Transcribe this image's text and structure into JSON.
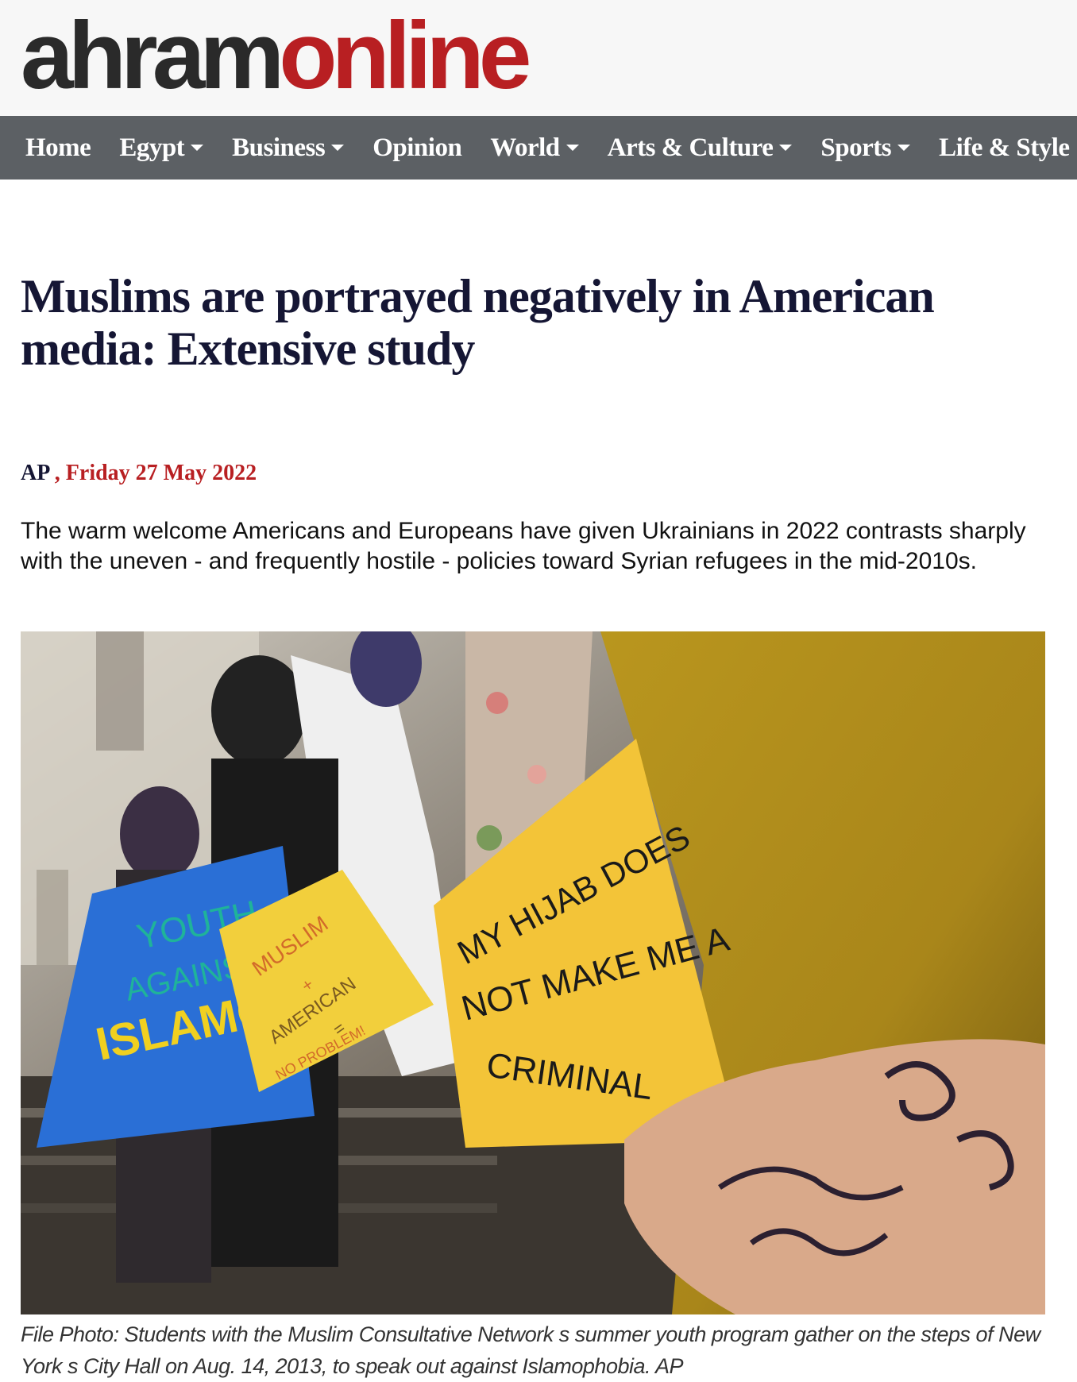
{
  "site": {
    "logo_part1": "ahram",
    "logo_part2": "online",
    "colors": {
      "brand_dark": "#2a2a2a",
      "brand_red": "#b81f22",
      "nav_bg": "#5c6064",
      "headline": "#151634"
    }
  },
  "nav": {
    "items": [
      {
        "label": "Home",
        "dropdown": false
      },
      {
        "label": "Egypt",
        "dropdown": true
      },
      {
        "label": "Business",
        "dropdown": true
      },
      {
        "label": "Opinion",
        "dropdown": false
      },
      {
        "label": "World",
        "dropdown": true
      },
      {
        "label": "Arts & Culture",
        "dropdown": true
      },
      {
        "label": "Sports",
        "dropdown": true
      },
      {
        "label": "Life & Style",
        "dropdown": false
      }
    ]
  },
  "article": {
    "headline": "Muslims are portrayed negatively in American media: Extensive study",
    "source": "AP",
    "separator": " , ",
    "date": "Friday 27 May 2022",
    "summary": "The warm welcome Americans and Europeans have given Ukrainians in 2022 contrasts sharply with the uneven - and frequently hostile - policies toward Syrian refugees in the mid-2010s.",
    "photo": {
      "sign1": "MY HIJAB DOES",
      "sign2": "NOT MAKE ME A",
      "sign3": "CRIMINAL",
      "sign_b1": "MUSLIM",
      "sign_b2": "+",
      "sign_b3": "AMERICAN",
      "sign_b4": "=",
      "sign_b5": "NO PROBLEM!",
      "sign_c1": "YOUTH",
      "sign_c2": "AGAINST",
      "sign_c3": "ISLAMOPH"
    },
    "caption": "File Photo: Students with the Muslim Consultative Network s summer youth program gather on the steps of New York s City Hall on Aug. 14, 2013, to speak out against Islamophobia. AP"
  }
}
